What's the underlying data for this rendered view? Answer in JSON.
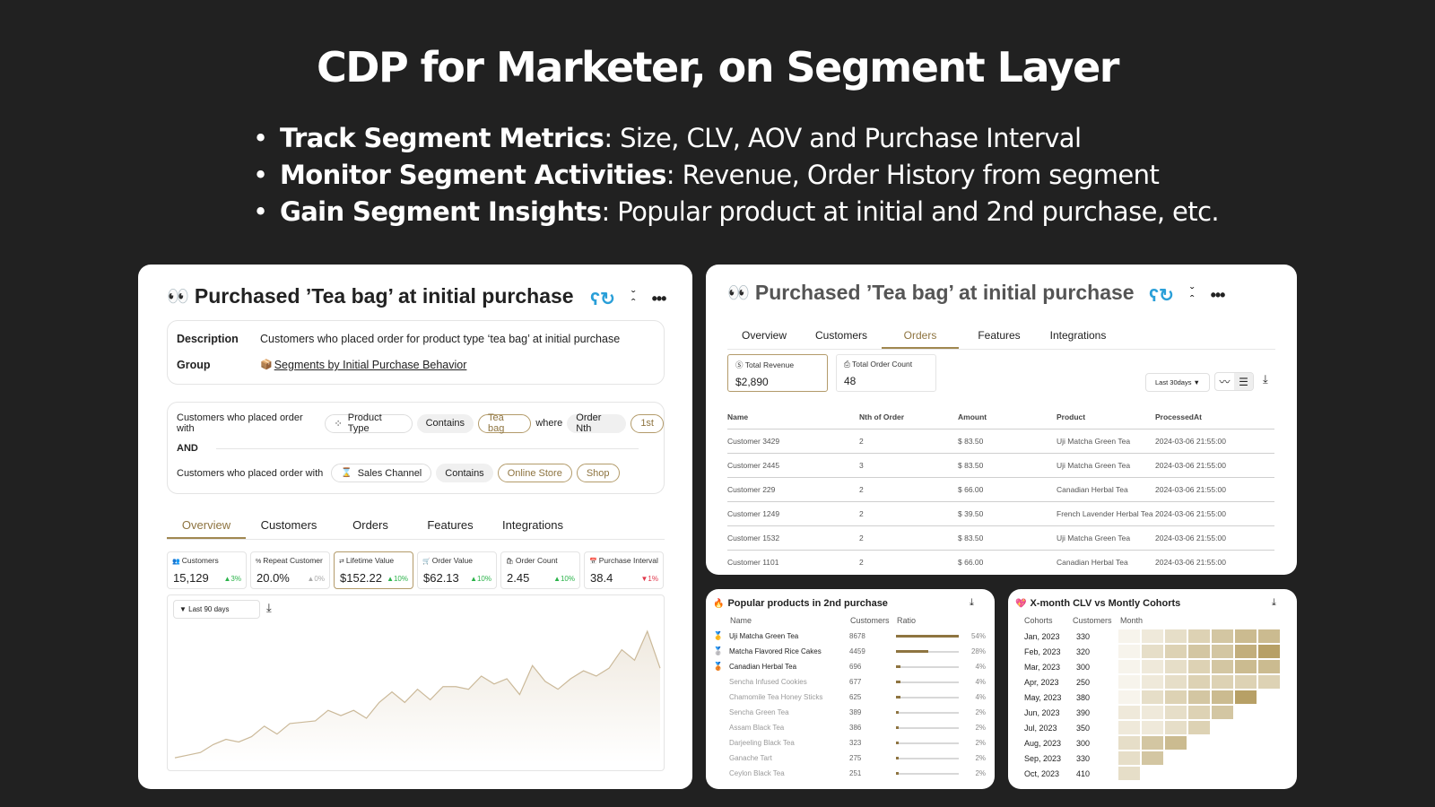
{
  "slide": {
    "title": "CDP for Marketer, on Segment Layer",
    "bullets": [
      {
        "bold": "Track Segment Metrics",
        "rest": ": Size, CLV, AOV and Purchase Interval"
      },
      {
        "bold": "Monitor Segment Activities",
        "rest": ": Revenue, Order History from segment"
      },
      {
        "bold": "Gain Segment Insights",
        "rest": ": Popular product at initial and 2nd purchase, etc."
      }
    ]
  },
  "segment": {
    "emoji": "👀",
    "title": "Purchased ’Tea bag’ at initial purchase",
    "icons": {
      "refresh": "↻",
      "collapse": "collapse-icon",
      "more": "•••"
    },
    "description_label": "Description",
    "description": "Customers who placed order for product type ‘tea bag’ at initial purchase",
    "group_label": "Group",
    "group_emoji": "📦",
    "group": "Segments by Initial Purchase Behavior",
    "conditions": {
      "row1": {
        "prefix": "Customers who placed order with",
        "field_icon": "⁘",
        "field": "Product Type",
        "op": "Contains",
        "value": "Tea bag",
        "where": "where",
        "field2": "Order Nth",
        "value2": "1st"
      },
      "and": "AND",
      "row2": {
        "prefix": "Customers who placed order with",
        "field_icon": "⌛",
        "field": "Sales Channel",
        "op": "Contains",
        "value": "Online Store",
        "value2": "Shop"
      }
    },
    "tabs": [
      "Overview",
      "Customers",
      "Orders",
      "Features",
      "Integrations"
    ],
    "metrics": [
      {
        "icon": "👥",
        "label": "Customers",
        "value": "15,129",
        "delta": "▲3%",
        "trend": "up"
      },
      {
        "icon": "%",
        "label": "Repeat Customer",
        "value": "20.0%",
        "delta": "▲0%",
        "trend": "flat"
      },
      {
        "icon": "⇄",
        "label": "Lifetime Value",
        "value": "$152.22",
        "delta": "▲10%",
        "trend": "up"
      },
      {
        "icon": "🛒",
        "label": "Order Value",
        "value": "$62.13",
        "delta": "▲10%",
        "trend": "up"
      },
      {
        "icon": "🛍",
        "label": "Order Count",
        "value": "2.45",
        "delta": "▲10%",
        "trend": "up"
      },
      {
        "icon": "📅",
        "label": "Purchase Interval",
        "value": "38.4",
        "delta": "▼1%",
        "trend": "down"
      }
    ],
    "range": "▼ Last 90 days",
    "download": "⤓"
  },
  "trend_chart": {
    "type": "area",
    "series": [
      2,
      3,
      4,
      7,
      9,
      8,
      10,
      14,
      11,
      15,
      15.5,
      16,
      20,
      18,
      20,
      17,
      23,
      27,
      23,
      28,
      24,
      29,
      29,
      28,
      33,
      30,
      32,
      26,
      37,
      31,
      28,
      32,
      35,
      33,
      36,
      43,
      39,
      50,
      36
    ]
  },
  "orders": {
    "emoji": "👀",
    "title": "Purchased ’Tea bag’ at initial purchase",
    "tabs": [
      "Overview",
      "Customers",
      "Orders",
      "Features",
      "Integrations"
    ],
    "active_tab": 2,
    "total_revenue_label": "Total Revenue",
    "total_revenue": "$2,890",
    "total_count_label": "Total Order Count",
    "total_count": "48",
    "range": "Last 30days ▼",
    "columns": [
      "Name",
      "Nth of Order",
      "Amount",
      "Product",
      "ProcessedAt"
    ],
    "rows": [
      [
        "Customer 3429",
        "2",
        "$ 83.50",
        "Uji Matcha Green Tea",
        "2024-03-06 21:55:00"
      ],
      [
        "Customer 2445",
        "3",
        "$ 83.50",
        "Uji Matcha Green Tea",
        "2024-03-06 21:55:00"
      ],
      [
        "Customer 229",
        "2",
        "$ 66.00",
        "Canadian Herbal Tea",
        "2024-03-06 21:55:00"
      ],
      [
        "Customer 1249",
        "2",
        "$ 39.50",
        "French Lavender Herbal Tea",
        "2024-03-06 21:55:00"
      ],
      [
        "Customer 1532",
        "2",
        "$ 83.50",
        "Uji Matcha Green Tea",
        "2024-03-06 21:55:00"
      ],
      [
        "Customer 1101",
        "2",
        "$ 66.00",
        "Canadian Herbal Tea",
        "2024-03-06 21:55:00"
      ]
    ]
  },
  "popular": {
    "emoji": "🔥",
    "title": "Popular products in 2nd purchase",
    "headers": [
      "Name",
      "Customers",
      "Ratio"
    ],
    "rows": [
      {
        "medal": "🥇",
        "name": "Uji Matcha Green Tea",
        "customers": "8678",
        "ratio": 54,
        "ratio_label": "54%"
      },
      {
        "medal": "🥈",
        "name": "Matcha Flavored Rice Cakes",
        "customers": "4459",
        "ratio": 28,
        "ratio_label": "28%"
      },
      {
        "medal": "🥉",
        "name": "Canadian Herbal Tea",
        "customers": "696",
        "ratio": 4,
        "ratio_label": "4%"
      },
      {
        "medal": "",
        "name": "Sencha Infused Cookies",
        "customers": "677",
        "ratio": 4,
        "ratio_label": "4%"
      },
      {
        "medal": "",
        "name": "Chamomile Tea Honey Sticks",
        "customers": "625",
        "ratio": 4,
        "ratio_label": "4%"
      },
      {
        "medal": "",
        "name": "Sencha Green Tea",
        "customers": "389",
        "ratio": 2,
        "ratio_label": "2%"
      },
      {
        "medal": "",
        "name": "Assam Black Tea",
        "customers": "386",
        "ratio": 2,
        "ratio_label": "2%"
      },
      {
        "medal": "",
        "name": "Darjeeling Black Tea",
        "customers": "323",
        "ratio": 2,
        "ratio_label": "2%"
      },
      {
        "medal": "",
        "name": "Ganache Tart",
        "customers": "275",
        "ratio": 2,
        "ratio_label": "2%"
      },
      {
        "medal": "",
        "name": "Ceylon Black Tea",
        "customers": "251",
        "ratio": 2,
        "ratio_label": "2%"
      }
    ]
  },
  "cohorts": {
    "emoji": "💖",
    "title": "X-month CLV vs Montly Cohorts",
    "headers": [
      "Cohorts",
      "Customers",
      "Month"
    ],
    "rows": [
      {
        "cohort": "Jan, 2023",
        "customers": "330",
        "levels": [
          1,
          2,
          3,
          4,
          5,
          6,
          6
        ]
      },
      {
        "cohort": "Feb, 2023",
        "customers": "320",
        "levels": [
          1,
          3,
          4,
          5,
          5,
          7,
          8
        ]
      },
      {
        "cohort": "Mar, 2023",
        "customers": "300",
        "levels": [
          1,
          2,
          3,
          4,
          5,
          6,
          6
        ]
      },
      {
        "cohort": "Apr, 2023",
        "customers": "250",
        "levels": [
          1,
          2,
          3,
          4,
          4,
          4,
          4
        ]
      },
      {
        "cohort": "May, 2023",
        "customers": "380",
        "levels": [
          1,
          3,
          4,
          5,
          6,
          8
        ]
      },
      {
        "cohort": "Jun, 2023",
        "customers": "390",
        "levels": [
          2,
          2,
          3,
          4,
          5
        ]
      },
      {
        "cohort": "Jul, 2023",
        "customers": "350",
        "levels": [
          2,
          2,
          3,
          4
        ]
      },
      {
        "cohort": "Aug, 2023",
        "customers": "300",
        "levels": [
          3,
          5,
          6
        ]
      },
      {
        "cohort": "Sep, 2023",
        "customers": "330",
        "levels": [
          3,
          5
        ]
      },
      {
        "cohort": "Oct, 2023",
        "customers": "410",
        "levels": [
          3
        ]
      }
    ],
    "palette": [
      "#ffffff",
      "#f7f4ec",
      "#efe9da",
      "#e6dec8",
      "#ddd2b4",
      "#d3c6a2",
      "#cbbb90",
      "#c2ae7c",
      "#b7a066"
    ]
  }
}
